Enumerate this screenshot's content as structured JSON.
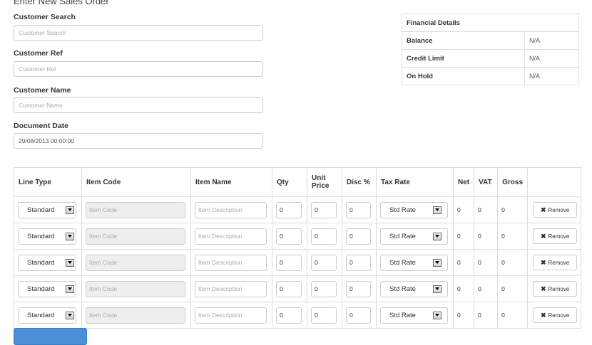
{
  "page": {
    "title": "Enter New Sales Order"
  },
  "form": {
    "customer_search": {
      "label": "Customer Search",
      "placeholder": "Customer Search",
      "value": ""
    },
    "customer_ref": {
      "label": "Customer Ref",
      "placeholder": "Customer Ref",
      "value": ""
    },
    "customer_name": {
      "label": "Customer Name",
      "placeholder": "Customer Name",
      "value": ""
    },
    "document_date": {
      "label": "Document Date",
      "value": "29/08/2013 00:00:00"
    }
  },
  "financial": {
    "title": "Financial Details",
    "rows": [
      {
        "label": "Balance",
        "value": "N/A"
      },
      {
        "label": "Credit Limit",
        "value": "N/A"
      },
      {
        "label": "On Hold",
        "value": "N/A"
      }
    ]
  },
  "lines": {
    "headers": {
      "line_type": "Line Type",
      "item_code": "Item Code",
      "item_name": "Item Name",
      "qty": "Qty",
      "unit_price": "Unit Price",
      "disc": "Disc %",
      "tax_rate": "Tax Rate",
      "net": "Net",
      "vat": "VAT",
      "gross": "Gross"
    },
    "placeholders": {
      "item_code": "Item Code",
      "item_name": "Item Description"
    },
    "rows": [
      {
        "line_type": "Standard",
        "qty": "0",
        "unit_price": "0",
        "disc": "0",
        "tax_rate": "Std Rate",
        "net": "0",
        "vat": "0",
        "gross": "0",
        "remove": "Remove"
      },
      {
        "line_type": "Standard",
        "qty": "0",
        "unit_price": "0",
        "disc": "0",
        "tax_rate": "Std Rate",
        "net": "0",
        "vat": "0",
        "gross": "0",
        "remove": "Remove"
      },
      {
        "line_type": "Standard",
        "qty": "0",
        "unit_price": "0",
        "disc": "0",
        "tax_rate": "Std Rate",
        "net": "0",
        "vat": "0",
        "gross": "0",
        "remove": "Remove"
      },
      {
        "line_type": "Standard",
        "qty": "0",
        "unit_price": "0",
        "disc": "0",
        "tax_rate": "Std Rate",
        "net": "0",
        "vat": "0",
        "gross": "0",
        "remove": "Remove"
      },
      {
        "line_type": "Standard",
        "qty": "0",
        "unit_price": "0",
        "disc": "0",
        "tax_rate": "Std Rate",
        "net": "0",
        "vat": "0",
        "gross": "0",
        "remove": "Remove"
      }
    ]
  },
  "colors": {
    "accent": "#4a90d9",
    "border": "#dddddd"
  }
}
